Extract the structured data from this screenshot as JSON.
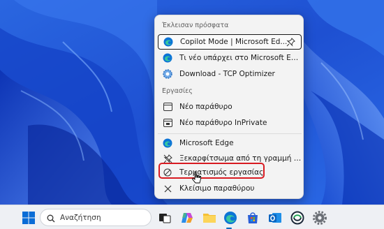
{
  "jumplist": {
    "recent_header": "Έκλεισαν πρόσφατα",
    "recent_items": [
      {
        "label": "Copilot Mode | Microsoft Ed...",
        "icon": "edge-icon"
      },
      {
        "label": "Τι νέο υπάρχει στο Microsoft Edge",
        "icon": "edge-icon"
      },
      {
        "label": "Download - TCP Optimizer",
        "icon": "gear-icon"
      }
    ],
    "tasks_header": "Εργασίες",
    "tasks": [
      {
        "label": "Νέο παράθυρο",
        "icon": "window-icon"
      },
      {
        "label": "Νέο παράθυρο InPrivate",
        "icon": "inprivate-window-icon"
      }
    ],
    "app_items": [
      {
        "label": "Microsoft Edge",
        "icon": "edge-icon"
      },
      {
        "label": "Ξεκαρφίτσωμα από τη γραμμή εργ...",
        "icon": "unpin-icon"
      },
      {
        "label": "Τερματισμός εργασίας",
        "icon": "end-task-icon"
      },
      {
        "label": "Κλείσιμο παραθύρου",
        "icon": "close-icon"
      }
    ]
  },
  "taskbar": {
    "search_placeholder": "Αναζήτηση",
    "icons": [
      "windows-start-icon",
      "search-icon",
      "task-view-icon",
      "copilot-icon",
      "file-explorer-icon",
      "edge-icon",
      "microsoft-store-icon",
      "outlook-icon",
      "app-icon",
      "settings-gear-icon"
    ]
  },
  "colors": {
    "highlight": "#d81b22",
    "wallpaper": "#1f57d6",
    "accent": "#0067c0"
  }
}
